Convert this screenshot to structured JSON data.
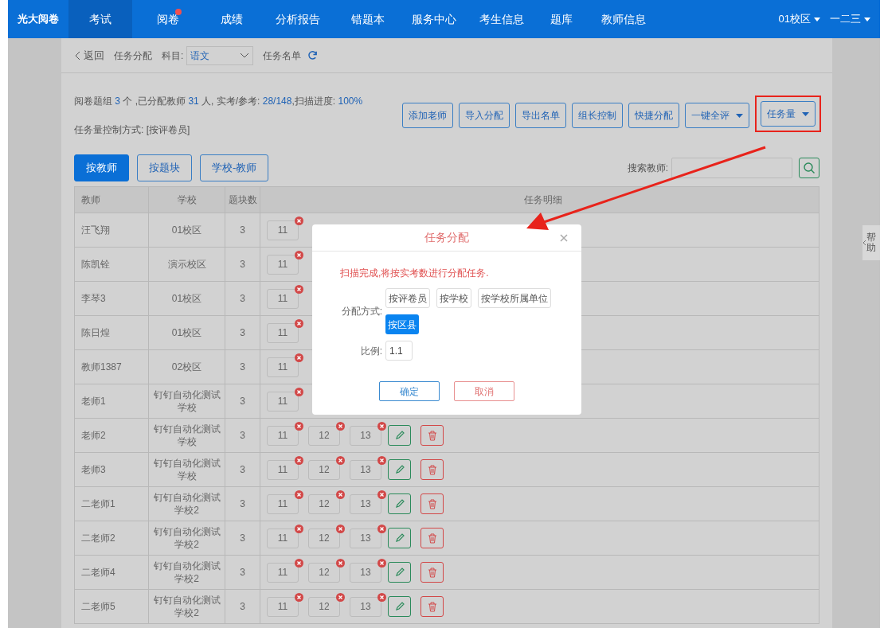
{
  "nav": {
    "logo": "光大阅卷",
    "items": [
      {
        "label": "考试",
        "selected": true,
        "dot": false
      },
      {
        "label": "阅卷",
        "selected": false,
        "dot": true
      },
      {
        "label": "成绩",
        "selected": false,
        "dot": false
      },
      {
        "label": "分析报告",
        "selected": false,
        "dot": false
      },
      {
        "label": "错题本",
        "selected": false,
        "dot": false
      },
      {
        "label": "服务中心",
        "selected": false,
        "dot": false
      },
      {
        "label": "考生信息",
        "selected": false,
        "dot": false
      },
      {
        "label": "题库",
        "selected": false,
        "dot": false
      },
      {
        "label": "教师信息",
        "selected": false,
        "dot": false
      }
    ],
    "right": [
      "01校区",
      "一二三"
    ]
  },
  "breadcrumb": {
    "back": "返回",
    "current": "任务分配",
    "subject_label": "科目:",
    "subject": "语文",
    "list_link": "任务名单"
  },
  "info": {
    "summary": "阅卷题组 3 个 ,已分配教师 31 人, 实考/参考: 28/148,扫描进度: 100%",
    "control_mode": "任务量控制方式: [按评卷员]"
  },
  "actions": [
    {
      "label": "添加老师",
      "dropdown": false,
      "highlighted": false
    },
    {
      "label": "导入分配",
      "dropdown": false,
      "highlighted": false
    },
    {
      "label": "导出名单",
      "dropdown": false,
      "highlighted": false
    },
    {
      "label": "组长控制",
      "dropdown": false,
      "highlighted": false
    },
    {
      "label": "快捷分配",
      "dropdown": false,
      "highlighted": false
    },
    {
      "label": "一键全评",
      "dropdown": true,
      "highlighted": false
    },
    {
      "label": "任务量",
      "dropdown": true,
      "highlighted": true
    }
  ],
  "view_tabs": [
    {
      "label": "按教师",
      "selected": true
    },
    {
      "label": "按题块",
      "selected": false
    },
    {
      "label": "学校-教师",
      "selected": false
    }
  ],
  "search": {
    "label": "搜索教师:"
  },
  "table": {
    "columns": [
      "教师",
      "学校",
      "题块数",
      "任务明细"
    ],
    "rows": [
      {
        "teacher": "汪飞翔",
        "school": "01校区",
        "blocks": "3",
        "tasks": [
          "11"
        ]
      },
      {
        "teacher": "陈凯铨",
        "school": "演示校区",
        "blocks": "3",
        "tasks": [
          "11"
        ]
      },
      {
        "teacher": "李琴3",
        "school": "01校区",
        "blocks": "3",
        "tasks": [
          "11"
        ]
      },
      {
        "teacher": "陈日煌",
        "school": "01校区",
        "blocks": "3",
        "tasks": [
          "11"
        ]
      },
      {
        "teacher": "教师1387",
        "school": "02校区",
        "blocks": "3",
        "tasks": [
          "11"
        ]
      },
      {
        "teacher": "老师1",
        "school": "钉钉自动化测试学校",
        "blocks": "3",
        "tasks": [
          "11"
        ]
      },
      {
        "teacher": "老师2",
        "school": "钉钉自动化测试学校",
        "blocks": "3",
        "tasks": [
          "11",
          "12",
          "13"
        ]
      },
      {
        "teacher": "老师3",
        "school": "钉钉自动化测试学校",
        "blocks": "3",
        "tasks": [
          "11",
          "12",
          "13"
        ]
      },
      {
        "teacher": "二老师1",
        "school": "钉钉自动化测试学校2",
        "blocks": "3",
        "tasks": [
          "11",
          "12",
          "13"
        ]
      },
      {
        "teacher": "二老师2",
        "school": "钉钉自动化测试学校2",
        "blocks": "3",
        "tasks": [
          "11",
          "12",
          "13"
        ]
      },
      {
        "teacher": "二老师4",
        "school": "钉钉自动化测试学校2",
        "blocks": "3",
        "tasks": [
          "11",
          "12",
          "13"
        ]
      },
      {
        "teacher": "二老师5",
        "school": "钉钉自动化测试学校2",
        "blocks": "3",
        "tasks": [
          "11",
          "12",
          "13"
        ]
      }
    ]
  },
  "help_tab": "帮助",
  "dialog": {
    "title": "任务分配",
    "message": "扫描完成,将按实考数进行分配任务.",
    "method_label": "分配方式:",
    "methods": [
      {
        "label": "按评卷员",
        "selected": false
      },
      {
        "label": "按学校",
        "selected": false
      },
      {
        "label": "按学校所属单位",
        "selected": false
      },
      {
        "label": "按区县",
        "selected": true
      }
    ],
    "ratio_label": "比例:",
    "ratio": "1.1",
    "confirm": "确定",
    "cancel": "取消"
  }
}
